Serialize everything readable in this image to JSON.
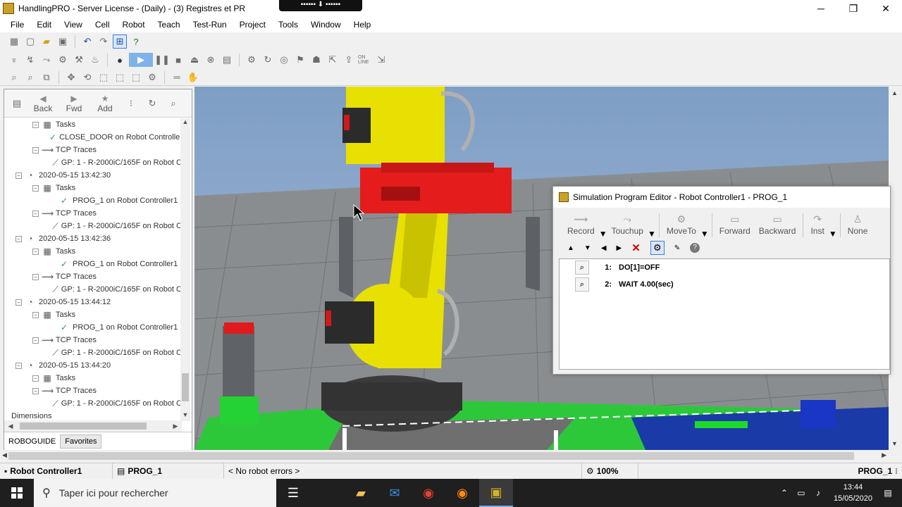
{
  "window": {
    "title": "HandlingPRO - Server License - (Daily) - (3) Registres et PR",
    "minimize": "─",
    "maximize": "❐",
    "close": "✕"
  },
  "menu": [
    "File",
    "Edit",
    "View",
    "Cell",
    "Robot",
    "Teach",
    "Test-Run",
    "Project",
    "Tools",
    "Window",
    "Help"
  ],
  "nav": {
    "back": "Back",
    "fwd": "Fwd",
    "add": "Add"
  },
  "tree": [
    {
      "indent": 1,
      "type": "folder",
      "label": "Tasks",
      "exp": "⊟"
    },
    {
      "indent": 2,
      "type": "check",
      "label": "CLOSE_DOOR on Robot Controller"
    },
    {
      "indent": 1,
      "type": "trace",
      "label": "TCP Traces",
      "exp": "⊟"
    },
    {
      "indent": 2,
      "type": "path",
      "label": "GP: 1 - R-2000iC/165F on Robot C"
    },
    {
      "indent": 0,
      "type": "date",
      "label": "2020-05-15 13:42:30",
      "exp": "⊟"
    },
    {
      "indent": 1,
      "type": "folder",
      "label": "Tasks",
      "exp": "⊟"
    },
    {
      "indent": 2,
      "type": "check",
      "label": "PROG_1 on Robot Controller1"
    },
    {
      "indent": 1,
      "type": "trace",
      "label": "TCP Traces",
      "exp": "⊟"
    },
    {
      "indent": 2,
      "type": "path",
      "label": "GP: 1 - R-2000iC/165F on Robot C"
    },
    {
      "indent": 0,
      "type": "date",
      "label": "2020-05-15 13:42:36",
      "exp": "⊟"
    },
    {
      "indent": 1,
      "type": "folder",
      "label": "Tasks",
      "exp": "⊟"
    },
    {
      "indent": 2,
      "type": "check",
      "label": "PROG_1 on Robot Controller1"
    },
    {
      "indent": 1,
      "type": "trace",
      "label": "TCP Traces",
      "exp": "⊟"
    },
    {
      "indent": 2,
      "type": "path",
      "label": "GP: 1 - R-2000iC/165F on Robot C"
    },
    {
      "indent": 0,
      "type": "date",
      "label": "2020-05-15 13:44:12",
      "exp": "⊟"
    },
    {
      "indent": 1,
      "type": "folder",
      "label": "Tasks",
      "exp": "⊟"
    },
    {
      "indent": 2,
      "type": "check",
      "label": "PROG_1 on Robot Controller1"
    },
    {
      "indent": 1,
      "type": "trace",
      "label": "TCP Traces",
      "exp": "⊟"
    },
    {
      "indent": 2,
      "type": "path",
      "label": "GP: 1 - R-2000iC/165F on Robot C"
    },
    {
      "indent": 0,
      "type": "date",
      "label": "2020-05-15 13:44:20",
      "exp": "⊟"
    },
    {
      "indent": 1,
      "type": "folder",
      "label": "Tasks",
      "exp": "⊟"
    },
    {
      "indent": 1,
      "type": "trace",
      "label": "TCP Traces",
      "exp": "⊟"
    },
    {
      "indent": 2,
      "type": "path",
      "label": "GP: 1 - R-2000iC/165F on Robot C"
    },
    {
      "indent": -1,
      "type": "plain",
      "label": "Dimensions"
    }
  ],
  "tabs": {
    "roboguide": "ROBOGUIDE",
    "favorites": "Favorites"
  },
  "editor": {
    "title": "Simulation Program Editor - Robot Controller1 - PROG_1",
    "tools": {
      "record": "Record",
      "touchup": "Touchup",
      "moveto": "MoveTo",
      "forward": "Forward",
      "backward": "Backward",
      "inst": "Inst",
      "none": "None"
    },
    "lines": [
      {
        "num": "1:",
        "text": "DO[1]=OFF"
      },
      {
        "num": "2:",
        "text": "WAIT 4.00(sec)"
      }
    ]
  },
  "status": {
    "controller": "Robot Controller1",
    "program": "PROG_1",
    "errors": "< No robot errors >",
    "zoom": "100%",
    "right_program": "PROG_1"
  },
  "taskbar": {
    "search_placeholder": "Taper ici pour rechercher",
    "time": "13:44",
    "date": "15/05/2020"
  }
}
